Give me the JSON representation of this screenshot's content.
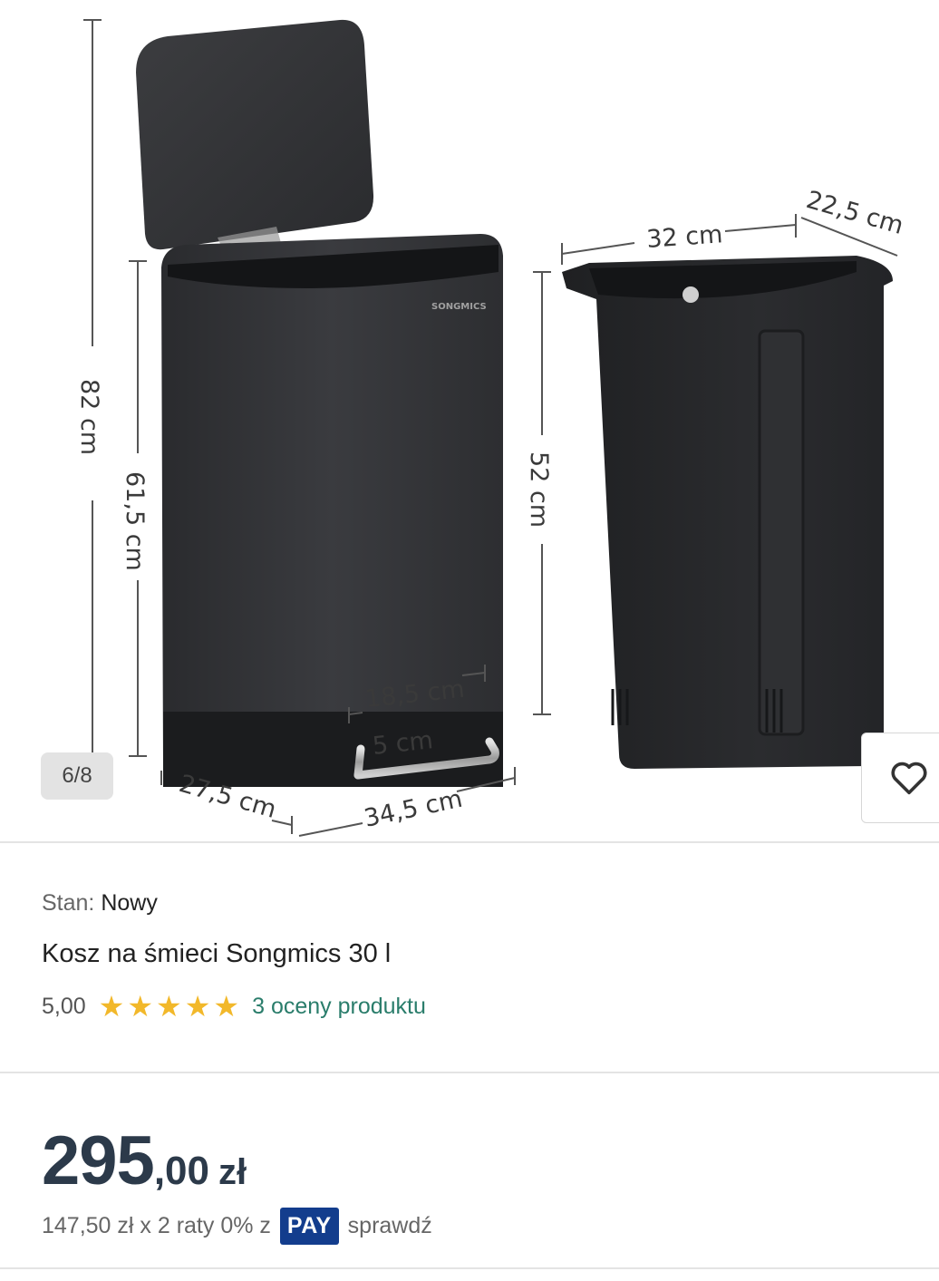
{
  "gallery": {
    "counter": "6/8",
    "brand_logo": "SONGMICS",
    "dimensions": {
      "total_height": "82 cm",
      "body_height": "61,5 cm",
      "depth": "27,5 cm",
      "width": "34,5 cm",
      "pedal_width": "18,5 cm",
      "pedal_depth": "5 cm",
      "inner_width": "32 cm",
      "inner_depth": "22,5 cm",
      "inner_height": "52 cm"
    },
    "favorite_icon": "heart-icon"
  },
  "product": {
    "condition_label": "Stan:",
    "condition_value": "Nowy",
    "title": "Kosz na śmieci Songmics 30 l",
    "rating": {
      "score": "5,00",
      "stars": 5,
      "max_stars": 5,
      "reviews_link": "3 oceny produktu"
    }
  },
  "pricing": {
    "price_int": "295",
    "price_dec": ",00",
    "currency": "zł",
    "installments_text": "147,50 zł x 2 raty 0% z",
    "pay_badge": "PAY",
    "check_link": "sprawdź"
  },
  "colors": {
    "star": "#f2b82a",
    "link": "#2a7d6b",
    "price": "#2c3a4a",
    "pay": "#133d8d"
  }
}
